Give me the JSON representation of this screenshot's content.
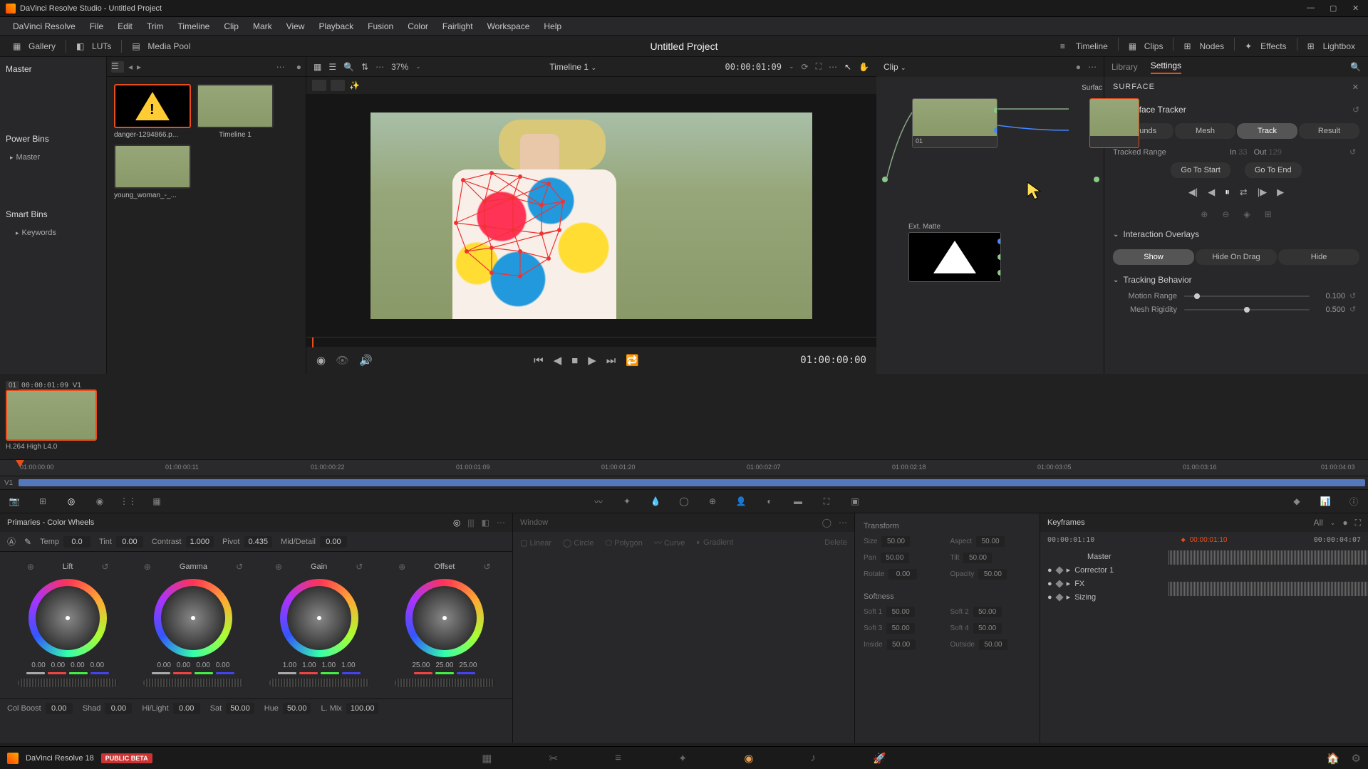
{
  "titlebar": {
    "title": "DaVinci Resolve Studio - Untitled Project"
  },
  "menu": [
    "DaVinci Resolve",
    "File",
    "Edit",
    "Trim",
    "Timeline",
    "Clip",
    "Mark",
    "View",
    "Playback",
    "Fusion",
    "Color",
    "Fairlight",
    "Workspace",
    "Help"
  ],
  "toolbar": {
    "gallery": "Gallery",
    "luts": "LUTs",
    "mediapool": "Media Pool",
    "project": "Untitled Project",
    "timeline": "Timeline",
    "clips": "Clips",
    "nodes": "Nodes",
    "effects": "Effects",
    "lightbox": "Lightbox"
  },
  "sidebar": {
    "master": "Master",
    "powerbins": "Power Bins",
    "master2": "Master",
    "smartbins": "Smart Bins",
    "keywords": "Keywords"
  },
  "thumbs": {
    "t1": "danger-1294866.p...",
    "t2": "Timeline 1",
    "t3": "young_woman_-_..."
  },
  "viewer": {
    "zoom": "37%",
    "timeline_name": "Timeline 1",
    "timecode_head": "00:00:01:09",
    "clip_label": "Clip",
    "timecode_play": "01:00:00:00"
  },
  "nodes": {
    "n1": "01",
    "ext": "Ext. Matte",
    "surf": "Surfac"
  },
  "inspector": {
    "tabs": {
      "library": "Library",
      "settings": "Settings"
    },
    "surface": "SURFACE",
    "tracker": "Surface Tracker",
    "seg": {
      "bounds": "Bounds",
      "mesh": "Mesh",
      "track": "Track",
      "result": "Result"
    },
    "tracked_range": "Tracked Range",
    "in_lbl": "In",
    "in_v": "33",
    "out_lbl": "Out",
    "out_v": "129",
    "goto_start": "Go To Start",
    "goto_end": "Go To End",
    "overlays": "Interaction Overlays",
    "show": "Show",
    "hideondrag": "Hide On Drag",
    "hide": "Hide",
    "behavior": "Tracking Behavior",
    "motion_range": "Motion Range",
    "motion_v": "0.100",
    "rigidity": "Mesh Rigidity",
    "rigidity_v": "0.500"
  },
  "clip": {
    "id": "01",
    "tc": "00:00:01:09",
    "track": "V1",
    "codec": "H.264 High L4.0"
  },
  "ruler": [
    "01:00:00:00",
    "01:00:00:11",
    "01:00:00:22",
    "01:00:01:09",
    "01:00:01:20",
    "01:00:02:07",
    "01:00:02:18",
    "01:00:03:05",
    "01:00:03:16",
    "01:00:04:03"
  ],
  "track_v1": "V1",
  "primaries": {
    "title": "Primaries - Color Wheels",
    "temp": "Temp",
    "temp_v": "0.0",
    "tint": "Tint",
    "tint_v": "0.00",
    "contrast": "Contrast",
    "contrast_v": "1.000",
    "pivot": "Pivot",
    "pivot_v": "0.435",
    "md": "Mid/Detail",
    "md_v": "0.00",
    "wheels": {
      "lift": {
        "name": "Lift",
        "vals": [
          "0.00",
          "0.00",
          "0.00",
          "0.00"
        ]
      },
      "gamma": {
        "name": "Gamma",
        "vals": [
          "0.00",
          "0.00",
          "0.00",
          "0.00"
        ]
      },
      "gain": {
        "name": "Gain",
        "vals": [
          "1.00",
          "1.00",
          "1.00",
          "1.00"
        ]
      },
      "offset": {
        "name": "Offset",
        "vals": [
          "25.00",
          "25.00",
          "25.00"
        ]
      }
    },
    "bottom": {
      "colboost": "Col Boost",
      "colboost_v": "0.00",
      "shad": "Shad",
      "shad_v": "0.00",
      "hl": "Hi/Light",
      "hl_v": "0.00",
      "sat": "Sat",
      "sat_v": "50.00",
      "hue": "Hue",
      "hue_v": "50.00",
      "lmix": "L. Mix",
      "lmix_v": "100.00"
    }
  },
  "window": {
    "title": "Window",
    "linear": "Linear",
    "circle": "Circle",
    "polygon": "Polygon",
    "curve": "Curve",
    "gradient": "Gradient",
    "delete": "Delete"
  },
  "transform": {
    "title": "Transform",
    "softness": "Softness",
    "size": "Size",
    "size_v": "50.00",
    "aspect": "Aspect",
    "aspect_v": "50.00",
    "pan": "Pan",
    "pan_v": "50.00",
    "tilt": "Tilt",
    "tilt_v": "50.00",
    "rotate": "Rotate",
    "rotate_v": "0.00",
    "opacity": "Opacity",
    "opacity_v": "50.00",
    "soft1": "Soft 1",
    "soft1_v": "50.00",
    "soft2": "Soft 2",
    "soft2_v": "50.00",
    "soft3": "Soft 3",
    "soft3_v": "50.00",
    "soft4": "Soft 4",
    "soft4_v": "50.00",
    "inside": "Inside",
    "inside_v": "50.00",
    "outside": "Outside",
    "outside_v": "50.00"
  },
  "keyframes": {
    "title": "Keyframes",
    "all": "All",
    "tc1": "00:00:01:10",
    "tc2": "00:00:01:10",
    "tc3": "00:00:04:07",
    "master": "Master",
    "corrector": "Corrector 1",
    "fx": "FX",
    "sizing": "Sizing"
  },
  "footer": {
    "app": "DaVinci Resolve 18",
    "beta": "PUBLIC BETA"
  }
}
